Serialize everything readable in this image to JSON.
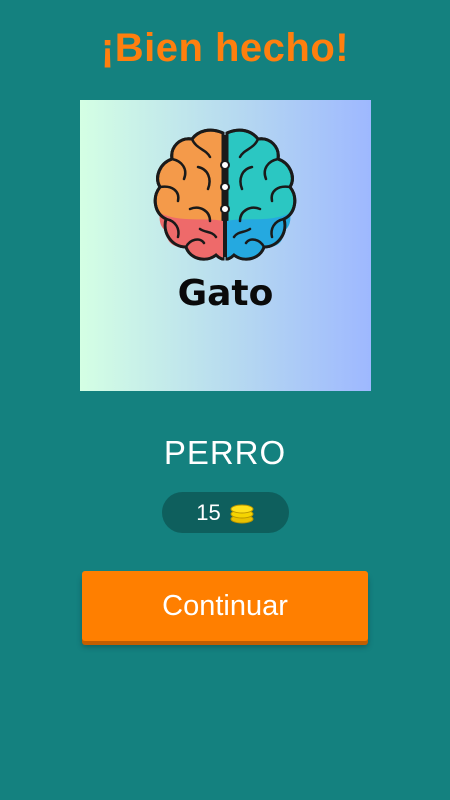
{
  "header": {
    "title": "¡Bien hecho!"
  },
  "card": {
    "word": "Gato",
    "icon": "brain-icon"
  },
  "answer": {
    "text": "PERRO"
  },
  "coins": {
    "count": "15",
    "icon": "coins-icon"
  },
  "actions": {
    "continue_label": "Continuar"
  },
  "colors": {
    "background": "#14817f",
    "title": "#ff7f0e",
    "button": "#ff7f00",
    "pill": "#0e5f5d"
  }
}
